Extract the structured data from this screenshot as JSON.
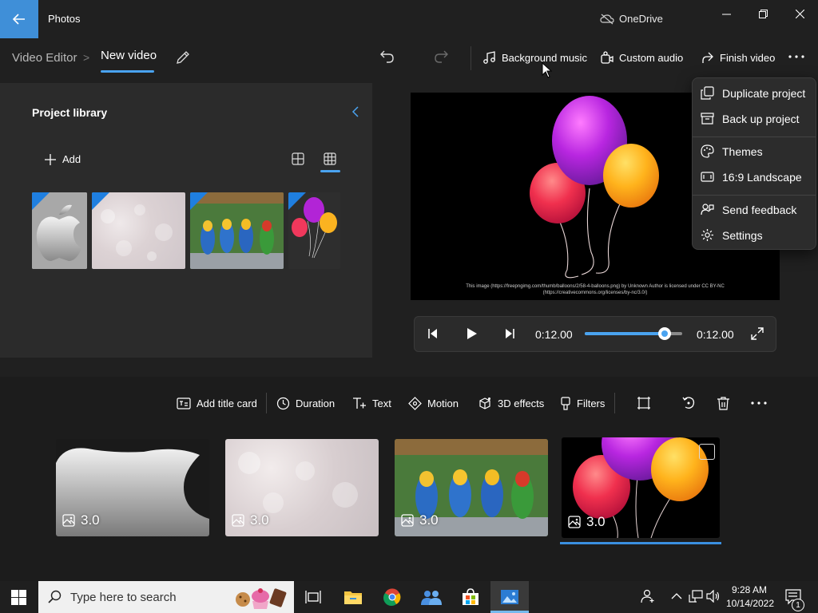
{
  "titlebar": {
    "app_title": "Photos",
    "onedrive_label": "OneDrive"
  },
  "breadcrumb": {
    "root": "Video Editor",
    "separator": ">",
    "current": "New video"
  },
  "toolbar": {
    "background_music": "Background music",
    "custom_audio": "Custom audio",
    "finish_video": "Finish video"
  },
  "library": {
    "title": "Project library",
    "add_label": "Add",
    "items": [
      {
        "name": "apple-logo",
        "icon": "apple-icon"
      },
      {
        "name": "bokeh-background"
      },
      {
        "name": "parrots"
      },
      {
        "name": "balloons"
      }
    ]
  },
  "preview": {
    "caption": "This image (https://freepngimg.com/thumb/balloons/2/58-4-balloons.png) by Unknown Author is licensed under CC BY-NC (https://creativecommons.org/licenses/by-nc/3.0/)",
    "time_current": "0:12.00",
    "time_total": "0:12.00",
    "seek_progress": 0.82
  },
  "more_menu": {
    "items": [
      "Duplicate project",
      "Back up project",
      "Themes",
      "16:9 Landscape",
      "Send feedback",
      "Settings"
    ]
  },
  "storyboard_tools": {
    "add_title_card": "Add title card",
    "duration": "Duration",
    "text": "Text",
    "motion": "Motion",
    "effects_3d": "3D effects",
    "filters": "Filters"
  },
  "clips": [
    {
      "duration": "3.0"
    },
    {
      "duration": "3.0"
    },
    {
      "duration": "3.0"
    },
    {
      "duration": "3.0",
      "selected": true
    }
  ],
  "taskbar": {
    "search_placeholder": "Type here to search",
    "time": "9:28 AM",
    "date": "10/14/2022",
    "notification_count": "1"
  },
  "colors": {
    "accent": "#4aa3f0",
    "back_button": "#3f8fd8",
    "panel": "#2b2b2b"
  }
}
